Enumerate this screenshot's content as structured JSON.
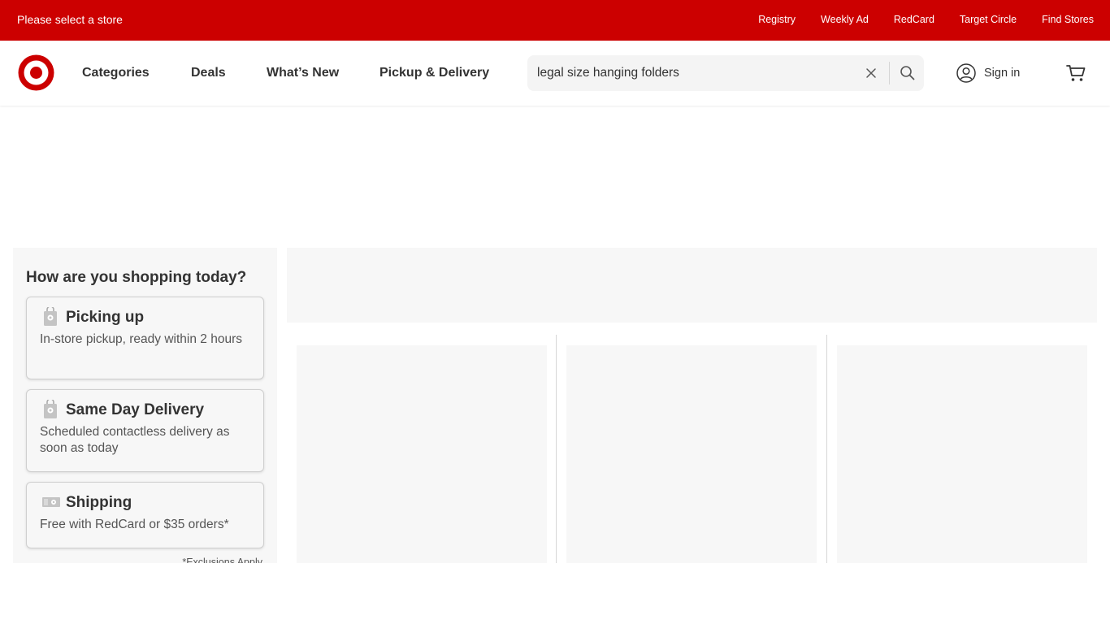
{
  "topbar": {
    "store_label": "Please select a store",
    "links": [
      "Registry",
      "Weekly Ad",
      "RedCard",
      "Target Circle",
      "Find Stores"
    ]
  },
  "header": {
    "logo_icon": "target-bullseye-icon",
    "nav": [
      "Categories",
      "Deals",
      "What’s New",
      "Pickup & Delivery"
    ],
    "search_value": "legal size hanging folders",
    "sign_in_label": "Sign in",
    "cart_icon": "cart-icon"
  },
  "shopping": {
    "heading": "How are you shopping today?",
    "options": [
      {
        "title": "Picking up",
        "desc": "In-store pickup, ready within 2 hours",
        "icon": "pickup-bag-icon"
      },
      {
        "title": "Same Day Delivery",
        "desc": "Scheduled contactless delivery as soon as today",
        "icon": "delivery-bag-icon"
      },
      {
        "title": "Shipping",
        "desc": "Free with RedCard or $35 orders*",
        "icon": "shipping-box-icon"
      }
    ],
    "exclusions": "*Exclusions Apply"
  },
  "colors": {
    "brand_red": "#cc0000",
    "placeholder_gray": "#f7f7f7"
  }
}
